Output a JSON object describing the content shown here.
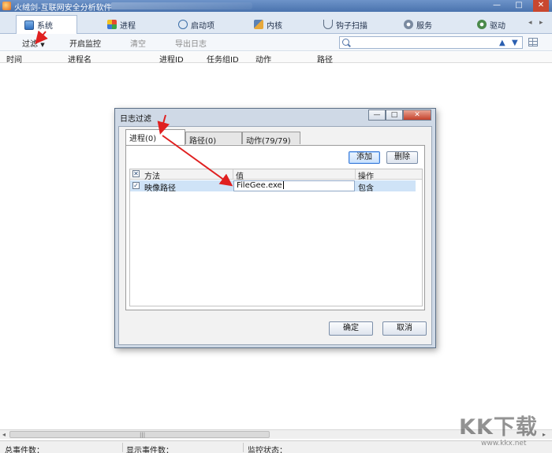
{
  "window": {
    "title": "火绒剑-互联网安全分析软件",
    "controls": {
      "minimize": "—",
      "maximize": "□",
      "close": "✕"
    }
  },
  "main_tabs": [
    {
      "label": "系统",
      "icon": "monitor-icon",
      "active": true
    },
    {
      "label": "进程",
      "icon": "process-icon"
    },
    {
      "label": "启动项",
      "icon": "startup-icon"
    },
    {
      "label": "内核",
      "icon": "kernel-icon"
    },
    {
      "label": "钩子扫描",
      "icon": "hook-icon"
    },
    {
      "label": "服务",
      "icon": "service-icon"
    },
    {
      "label": "驱动",
      "icon": "driver-icon"
    }
  ],
  "toolbar": {
    "filter": "过滤",
    "start_monitor": "开启监控",
    "clear": "清空",
    "export_log": "导出日志",
    "search_placeholder": "",
    "up_arrow": "▲",
    "down_arrow": "▼"
  },
  "columns": [
    "时间",
    "进程名",
    "进程ID",
    "任务组ID",
    "动作",
    "路径"
  ],
  "dialog": {
    "title": "日志过滤",
    "tabs": [
      {
        "label": "进程(0)",
        "active": true
      },
      {
        "label": "路径(0)"
      },
      {
        "label": "动作(79/79)"
      }
    ],
    "add_button": "添加",
    "delete_button": "删除",
    "grid_headers": {
      "method": "方法",
      "value": "值",
      "operation": "操作"
    },
    "rows": [
      {
        "checked": true,
        "method": "映像路径",
        "value": "FileGee.exe",
        "operation": "包含"
      }
    ],
    "ok_button": "确定",
    "cancel_button": "取消"
  },
  "statusbar": {
    "total_events": "总事件数：",
    "shown_events": "显示事件数：",
    "monitor_status": "监控状态："
  },
  "watermark": {
    "brand": "KK下载",
    "url": "www.kkx.net"
  },
  "colors": {
    "annotation_arrow": "#e02020",
    "selected_row": "#cfe3f7",
    "title_bar": "#4a73ad"
  }
}
